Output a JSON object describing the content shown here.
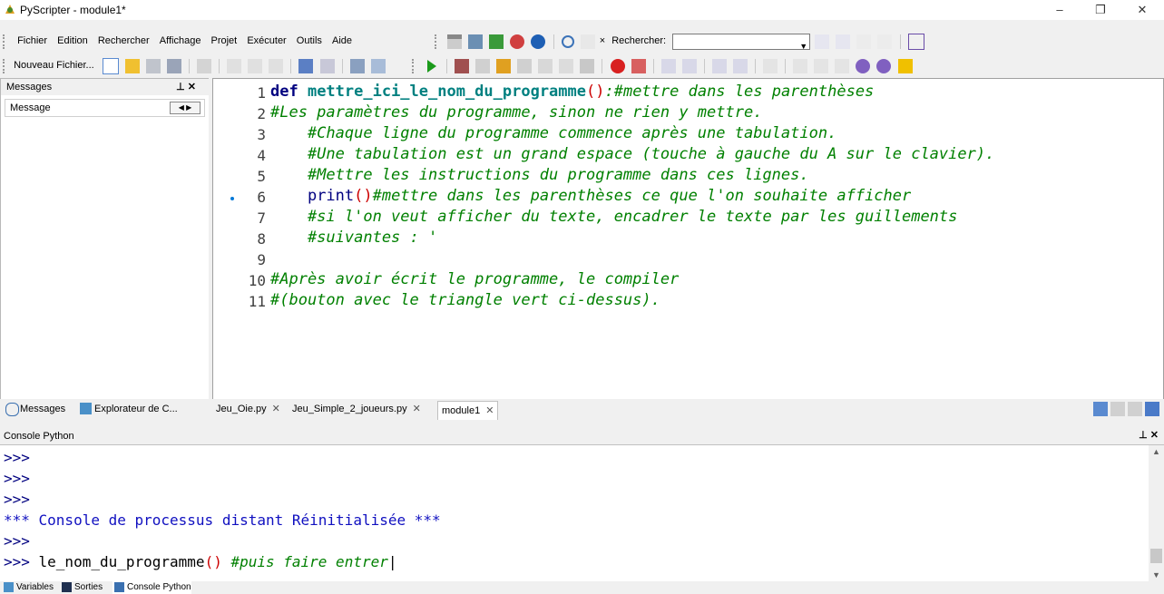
{
  "window": {
    "title": "PyScripter - module1*",
    "controls": {
      "minimize": "–",
      "restore": "❐",
      "close": "✕"
    }
  },
  "menu": [
    "Fichier",
    "Edition",
    "Rechercher",
    "Affichage",
    "Projet",
    "Exécuter",
    "Outils",
    "Aide"
  ],
  "search": {
    "label": "Rechercher:",
    "value": ""
  },
  "toolbar": {
    "new_file_label": "Nouveau Fichier..."
  },
  "left_panel": {
    "title": "Messages",
    "pin": "⊥ ✕",
    "column": "Message",
    "tabs": [
      "Messages",
      "Explorateur de C..."
    ]
  },
  "editor_tabs": [
    {
      "label": "Jeu_Oie.py",
      "close": "✕"
    },
    {
      "label": "Jeu_Simple_2_joueurs.py",
      "close": "✕"
    },
    {
      "label": "module1",
      "close": "✕"
    }
  ],
  "code": {
    "line_numbers": [
      "1",
      "2",
      "3",
      "4",
      "5",
      "6",
      "7",
      "8",
      "9",
      "10",
      "11"
    ],
    "l1_kw": "def",
    "l1_fn": " mettre_ici_le_nom_du_programme",
    "l1_paren": "()",
    "l1_rest": ":#mettre dans les parenthèses",
    "l2": "#Les paramètres du programme, sinon ne rien y mettre.",
    "l3": "    #Chaque ligne du programme commence après une tabulation.",
    "l4": "    #Une tabulation est un grand espace (touche à gauche du A sur le clavier).",
    "l5": "    #Mettre les instructions du programme dans ces lignes.",
    "l6_indent": "    ",
    "l6_bi": "print",
    "l6_paren": "()",
    "l6_rest": "#mettre dans les parenthèses ce que l'on souhaite afficher",
    "l7": "    #si l'on veut afficher du texte, encadrer le texte par les guillements",
    "l8": "    #suivantes : '",
    "l9": "",
    "l10": "#Après avoir écrit le programme, le compiler",
    "l11": "#(bouton avec le triangle vert ci-dessus)."
  },
  "console": {
    "title": "Console Python",
    "pin": "⊥ ✕",
    "lines": [
      ">>>",
      ">>>",
      ">>>",
      "*** Console de processus distant Réinitialisée ***",
      ">>>"
    ],
    "input_prompt": ">>> ",
    "input_code": "le_nom_du_programme",
    "input_paren": "()",
    "input_comment": " #puis faire entrer"
  },
  "bottom_tabs": [
    "Variables",
    "Sorties",
    "Console Python"
  ],
  "colors": {
    "keyword": "#000080",
    "comment": "#008000",
    "function": "#008080",
    "paren": "#cc0000"
  }
}
